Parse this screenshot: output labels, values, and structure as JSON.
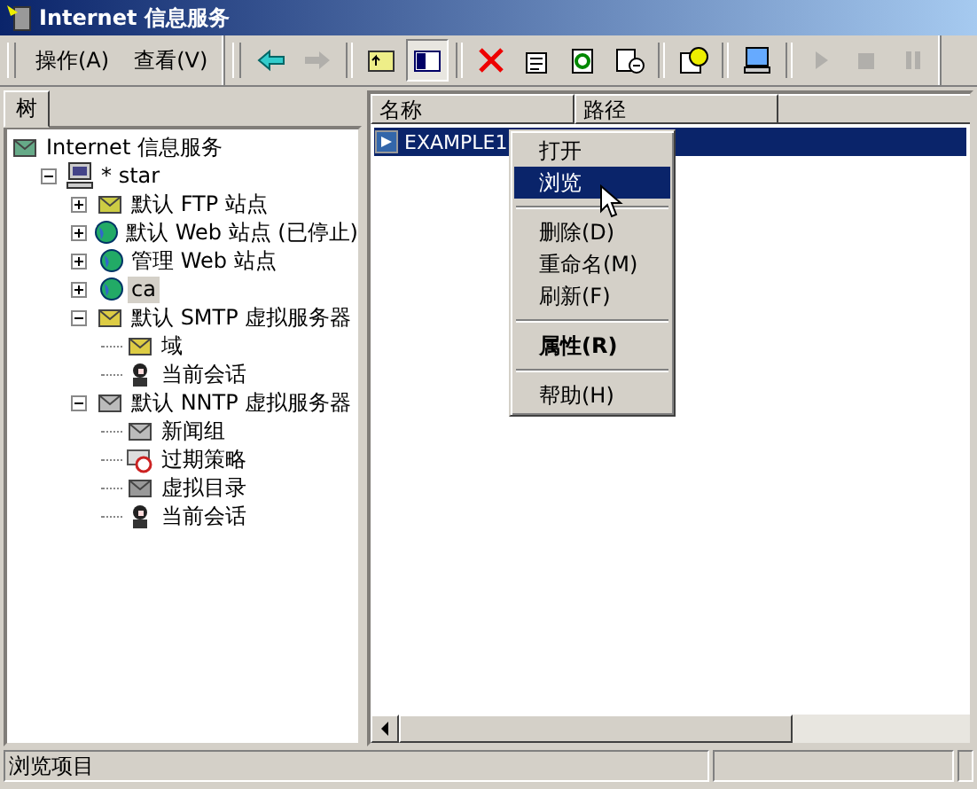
{
  "window": {
    "title": "Internet 信息服务"
  },
  "menu": [
    {
      "label": "操作(A)"
    },
    {
      "label": "查看(V)"
    }
  ],
  "toolbar": [
    {
      "kind": "back",
      "disabled": false,
      "pressed": false
    },
    {
      "kind": "forward",
      "disabled": true,
      "pressed": false
    },
    {
      "kind": "sep"
    },
    {
      "kind": "up",
      "disabled": false,
      "pressed": false
    },
    {
      "kind": "tree",
      "disabled": false,
      "pressed": true
    },
    {
      "kind": "sep"
    },
    {
      "kind": "delete",
      "disabled": false,
      "pressed": false
    },
    {
      "kind": "properties",
      "disabled": false,
      "pressed": false
    },
    {
      "kind": "refresh",
      "disabled": false,
      "pressed": false
    },
    {
      "kind": "export",
      "disabled": false,
      "pressed": false
    },
    {
      "kind": "sep"
    },
    {
      "kind": "help",
      "disabled": false,
      "pressed": false
    },
    {
      "kind": "sep"
    },
    {
      "kind": "computer",
      "disabled": false,
      "pressed": false
    },
    {
      "kind": "sep"
    },
    {
      "kind": "play",
      "disabled": true,
      "pressed": false
    },
    {
      "kind": "stop",
      "disabled": true,
      "pressed": false
    },
    {
      "kind": "pause",
      "disabled": true,
      "pressed": false
    }
  ],
  "tree_tab": {
    "label": "树",
    "selected": true
  },
  "tree": [
    {
      "label": "Internet 信息服务",
      "kind": "root",
      "selected": false,
      "children": [
        {
          "label": "* star",
          "kind": "computer",
          "expanded": true,
          "selected": false,
          "children": [
            {
              "label": "默认 FTP 站点",
              "kind": "ftp",
              "expanded": false,
              "selected": false
            },
            {
              "label": "默认 Web 站点 (已停止)",
              "kind": "web",
              "expanded": false,
              "selected": false
            },
            {
              "label": "管理 Web 站点",
              "kind": "web",
              "expanded": false,
              "selected": false
            },
            {
              "label": "ca",
              "kind": "web",
              "expanded": false,
              "selected": true
            },
            {
              "label": "默认 SMTP 虚拟服务器",
              "kind": "smtp",
              "expanded": true,
              "selected": false,
              "children": [
                {
                  "label": "域",
                  "kind": "domain",
                  "selected": false
                },
                {
                  "label": "当前会话",
                  "kind": "session",
                  "selected": false
                }
              ]
            },
            {
              "label": "默认 NNTP 虚拟服务器",
              "kind": "nntp",
              "expanded": true,
              "selected": false,
              "children": [
                {
                  "label": "新闻组",
                  "kind": "nntp",
                  "selected": false
                },
                {
                  "label": "过期策略",
                  "kind": "expire",
                  "selected": false
                },
                {
                  "label": "虚拟目录",
                  "kind": "vdir",
                  "selected": false
                },
                {
                  "label": "当前会话",
                  "kind": "session",
                  "selected": false
                }
              ]
            }
          ]
        }
      ]
    }
  ],
  "list": {
    "columns": [
      "名称",
      "路径"
    ],
    "rows": [
      {
        "name": "EXAMPLE1",
        "selected": true
      }
    ]
  },
  "context_menu": [
    {
      "kind": "item",
      "label": "打开",
      "selected": false,
      "default": false
    },
    {
      "kind": "item",
      "label": "浏览",
      "selected": true,
      "default": false
    },
    {
      "kind": "separator"
    },
    {
      "kind": "item",
      "label": "删除(D)",
      "selected": false,
      "default": false
    },
    {
      "kind": "item",
      "label": "重命名(M)",
      "selected": false,
      "default": false
    },
    {
      "kind": "item",
      "label": "刷新(F)",
      "selected": false,
      "default": false
    },
    {
      "kind": "separator"
    },
    {
      "kind": "item",
      "label": "属性(R)",
      "selected": false,
      "default": true
    },
    {
      "kind": "separator"
    },
    {
      "kind": "item",
      "label": "帮助(H)",
      "selected": false,
      "default": false
    }
  ],
  "status_bar": {
    "text": "浏览项目"
  }
}
